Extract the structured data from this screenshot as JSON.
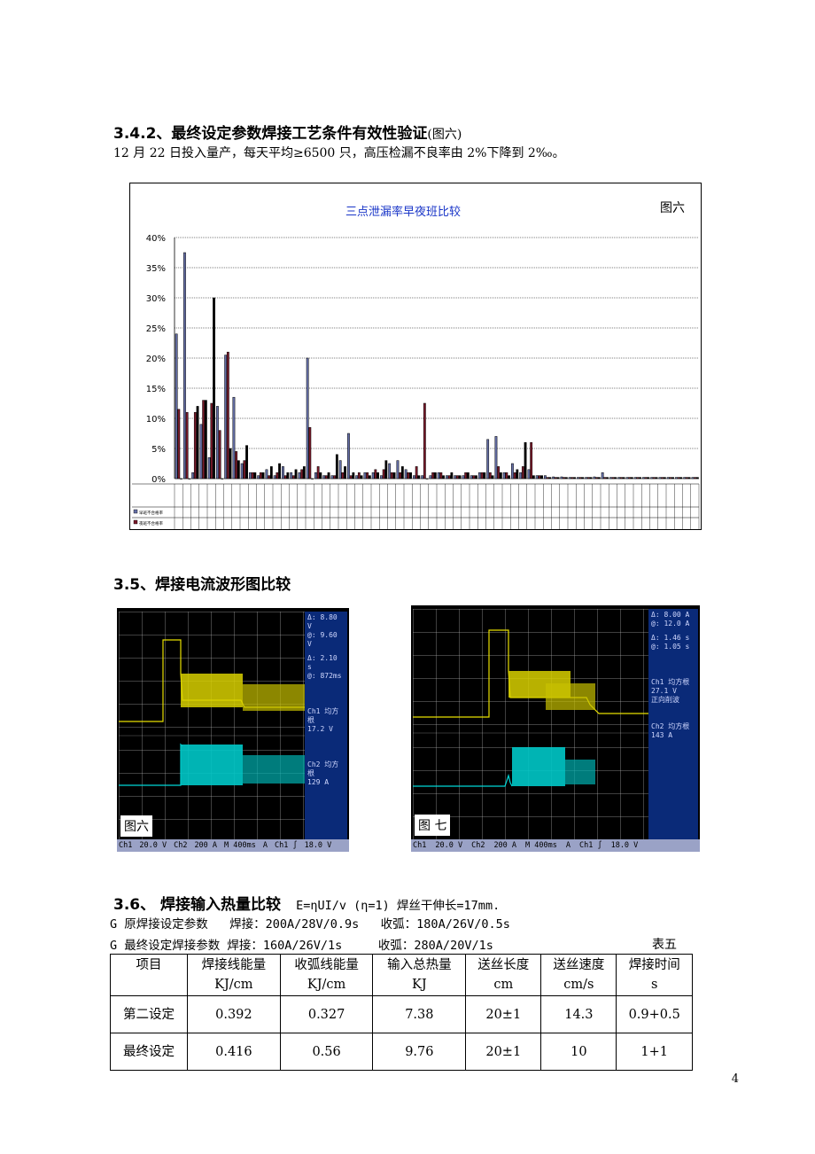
{
  "section_342": {
    "heading_bold": "3.4.2、最终设定参数焊接工艺条件有效性验证",
    "heading_suffix": "(图六)",
    "line": "12 月 22 日投入量产，每天平均≥6500 只，高压检漏不良率由 2%下降到 2‰。"
  },
  "chart_data": {
    "type": "bar",
    "title": "三点泄漏率早夜班比较",
    "figure_label": "图六",
    "ylabel": "",
    "xlabel": "",
    "ylim": [
      0,
      40
    ],
    "y_ticks": [
      "40%",
      "35%",
      "30%",
      "25%",
      "20%",
      "15%",
      "10%",
      "5%",
      "0%"
    ],
    "legend_rows": [
      "早班不合格率",
      "夜班不合格率"
    ],
    "categories_count": 64,
    "series": [
      {
        "name": "早班不合格率",
        "color": "#6670a8",
        "values": [
          24,
          37.5,
          1,
          9,
          3.5,
          12,
          20.5,
          13.5,
          2.5,
          1,
          0.5,
          1.5,
          0.5,
          2,
          1,
          1,
          20,
          1,
          0.5,
          0.5,
          3,
          7.5,
          0.5,
          1,
          1,
          0.5,
          2.5,
          3,
          1.5,
          0.5,
          0.5,
          0.5,
          1,
          0.5,
          0.5,
          0.5,
          0.5,
          1,
          6.5,
          7,
          1,
          2.5,
          1,
          1.5,
          0.5,
          0.5,
          0.3,
          0.3,
          0.2,
          0.2,
          0.2,
          0.3,
          1,
          0.2,
          0.2,
          0.2,
          0.2,
          0.2,
          0.2,
          0.2,
          0.2,
          0.2,
          0.2,
          0.2
        ]
      },
      {
        "name": "夜班不合格率",
        "color": "#7a1a2a",
        "values": [
          11.5,
          11,
          11,
          13,
          12.5,
          8,
          21,
          4.5,
          3,
          1,
          1,
          0.5,
          1,
          0.5,
          0.5,
          1.5,
          8.5,
          2,
          0.5,
          0.5,
          1,
          0.5,
          1,
          1,
          1.5,
          1.5,
          1,
          1,
          1,
          2,
          12.5,
          1,
          1,
          0.5,
          0.5,
          1,
          0.5,
          1,
          1,
          2,
          1,
          1,
          2,
          6,
          0.5,
          0.2,
          0.2,
          0.2,
          0.2,
          0.2,
          0.2,
          0.2,
          0.2,
          0.2,
          0.2,
          0.2,
          0.2,
          0.2,
          0.2,
          0.2,
          0.2,
          0.2,
          0.2,
          0.2
        ]
      },
      {
        "name": "",
        "color": "#000000",
        "values": [
          0,
          0,
          12,
          13,
          30,
          0,
          5,
          3,
          5.5,
          1,
          1,
          2,
          2.5,
          1,
          1.5,
          2,
          0,
          1,
          1,
          4,
          2,
          1,
          0.5,
          0.5,
          1,
          3,
          1,
          2,
          1,
          0.5,
          0,
          1,
          0.5,
          1,
          0.5,
          1,
          0.5,
          1,
          0.5,
          1,
          0.5,
          1.5,
          6,
          0.5,
          0.5,
          0.2,
          0.2,
          0.2,
          0.2,
          0.2,
          0.2,
          0.2,
          0.2,
          0.2,
          0.2,
          0.2,
          0.2,
          0.2,
          0.2,
          0.2,
          0.2,
          0.2,
          0.2,
          0.2
        ]
      }
    ],
    "grid": true
  },
  "section_35": {
    "heading": "3.5、焊接电流波形图比较",
    "scope_left": {
      "label": "图六",
      "delta_v": "Δ: 8.80 V",
      "at_v": "@: 9.60 V",
      "delta_t": "Δ: 2.10 s",
      "at_t": "@: 872ms",
      "ch1": "Ch1 均方根",
      "ch1_val": "17.2 V",
      "ch2": "Ch2 均方根",
      "ch2_val": "129 A",
      "bottom": [
        "Ch1",
        "20.0 V",
        "Ch2",
        "200 A",
        "M 400ms",
        "A",
        "Ch1 ∫",
        "18.0 V"
      ]
    },
    "scope_right": {
      "label": "图 七",
      "delta_v": "Δ: 8.00 A",
      "at_v": "@: 12.0 A",
      "delta_t": "Δ: 1.46 s",
      "at_t": "@: 1.05 s",
      "ch1": "Ch1 均方根",
      "ch1_val": "27.1 V",
      "ch1_extra": "正向削波",
      "ch2": "Ch2 均方根",
      "ch2_val": "143 A",
      "bottom": [
        "Ch1",
        "20.0 V",
        "Ch2",
        "200 A",
        "M 400ms",
        "A",
        "Ch1 ∫",
        "18.0 V"
      ]
    }
  },
  "section_36": {
    "heading": "3.6、  焊接输入热量比较",
    "formula": "E=ηUI/v   (η=1)  焊丝干伸长=17mm.",
    "line1_a": "G 原焊接设定参数   焊接：200A/28V/0.9s   收弧：180A/26V/0.5s",
    "line2_a": "G 最终设定焊接参数 焊接：160A/26V/1s     收弧：280A/20V/1s",
    "table_label": "表五",
    "table": {
      "header_top": [
        "项目",
        "焊接线能量",
        "收弧线能量",
        "输入总热量",
        "送丝长度",
        "送丝速度",
        "焊接时间"
      ],
      "header_units": [
        "",
        "KJ/cm",
        "KJ/cm",
        "KJ",
        "cm",
        "cm/s",
        "s"
      ],
      "rows": [
        [
          "第二设定",
          "0.392",
          "0.327",
          "7.38",
          "20±1",
          "14.3",
          "0.9+0.5"
        ],
        [
          "最终设定",
          "0.416",
          "0.56",
          "9.76",
          "20±1",
          "10",
          "1+1"
        ]
      ]
    }
  },
  "page_number": "4"
}
